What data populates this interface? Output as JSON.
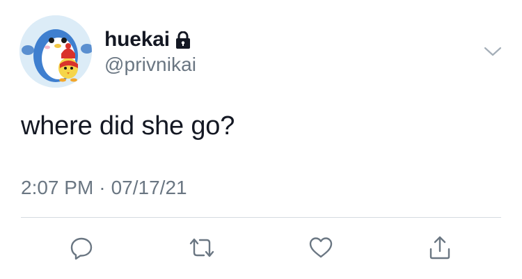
{
  "tweet": {
    "author": {
      "display_name": "huekai",
      "handle": "@privnikai",
      "protected_icon": "lock-icon",
      "avatar": "penguin-avatar"
    },
    "text": "where did she go?",
    "time": "2:07 PM",
    "separator": "·",
    "date": "07/17/21"
  },
  "actions": {
    "reply_icon": "reply-icon",
    "retweet_icon": "retweet-icon",
    "like_icon": "heart-icon",
    "share_icon": "share-icon",
    "menu_icon": "chevron-down-icon"
  },
  "colors": {
    "text": "#141823",
    "secondary": "#6a7682",
    "divider": "#d5dbe0"
  }
}
